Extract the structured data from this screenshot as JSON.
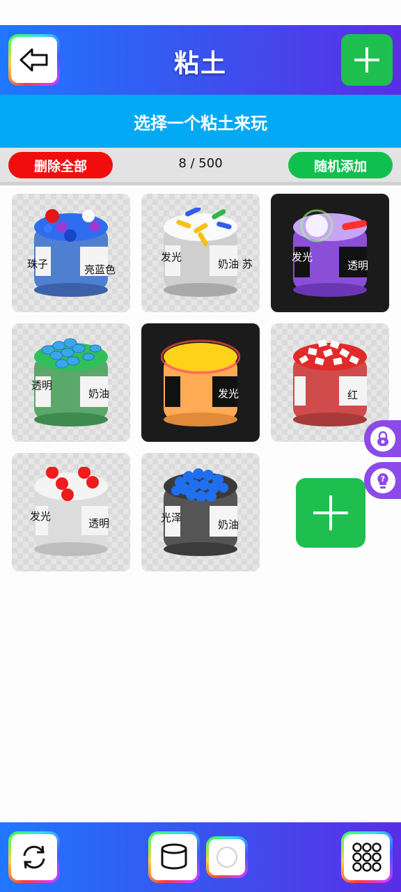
{
  "header": {
    "title": "粘土",
    "back_icon": "back-arrow-icon",
    "add_icon": "plus-icon"
  },
  "banner": {
    "text": "选择一个粘土来玩"
  },
  "toolbar": {
    "delete_all": "删除全部",
    "counter": "8 / 500",
    "random_add": "随机添加"
  },
  "slimes": [
    {
      "labels": [
        "珠子",
        "亮蓝色"
      ],
      "color": "#4f7fd0"
    },
    {
      "labels": [
        "发光",
        "奶油 苏"
      ],
      "color": "#d8d8d8"
    },
    {
      "labels": [
        "发光",
        "透明"
      ],
      "color": "#8a4fd6"
    },
    {
      "labels": [
        "透明",
        "奶油"
      ],
      "color": "#5aa86a"
    },
    {
      "labels": [
        "",
        "发光"
      ],
      "color": "#ffaa55"
    },
    {
      "labels": [
        "",
        "红"
      ],
      "color": "#d04c4c"
    },
    {
      "labels": [
        "发光",
        "透明"
      ],
      "color": "#dcdcdc"
    },
    {
      "labels": [
        "光泽",
        "奶油"
      ],
      "color": "#555555"
    }
  ],
  "side": {
    "lock_icon": "lock-icon",
    "hint_icon": "lightbulb-icon"
  },
  "footer": {
    "refresh_icon": "refresh-icon",
    "jar_icon": "jar-icon",
    "circle_icon": "circle-icon",
    "grid_icon": "grid-icon"
  },
  "colors": {
    "accent_green": "#1fbf4f",
    "banner_blue": "#03a9f4",
    "delete_red": "#f20d0d",
    "side_purple": "#8c4be8"
  }
}
